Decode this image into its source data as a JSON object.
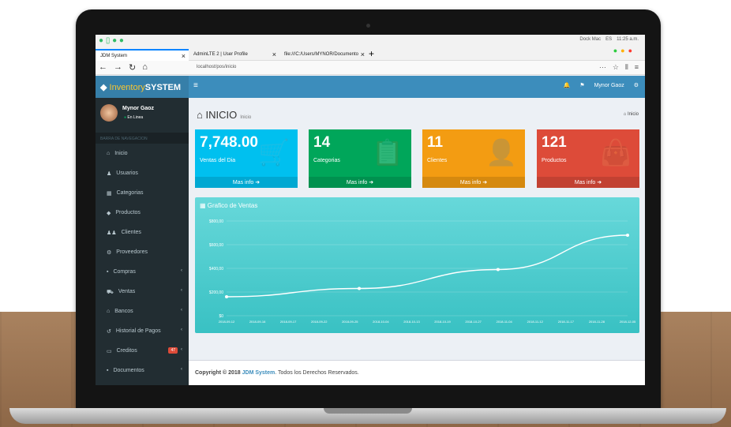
{
  "os": {
    "right_items": [
      "Dock Mac",
      "ES",
      "11:25 a.m."
    ]
  },
  "browser": {
    "tabs": [
      {
        "label": "JDM System",
        "active": true
      },
      {
        "label": "AdminLTE 2 | User Profile",
        "active": false
      },
      {
        "label": "file:///C:/Users/MYNOR/Documento",
        "active": false
      }
    ],
    "url": "localhost/pos/inicio"
  },
  "app": {
    "logo_light": "Inventory",
    "logo_bold": "SYSTEM",
    "menu_icon": "bars-icon",
    "header_user": "Mynor Gaoz"
  },
  "sidebar": {
    "user_name": "Mynor Gaoz",
    "user_status": "En Linea",
    "nav_header": "BARRA DE NAVEGACION",
    "items": [
      {
        "icon": "home-icon",
        "label": "Inicio"
      },
      {
        "icon": "user-icon",
        "label": "Usuarios"
      },
      {
        "icon": "table-icon",
        "label": "Categorias"
      },
      {
        "icon": "tag-icon",
        "label": "Productos"
      },
      {
        "icon": "users-icon",
        "label": "Clientes"
      },
      {
        "icon": "truck-icon",
        "label": "Proveedores"
      },
      {
        "icon": "briefcase-icon",
        "label": "Compras"
      },
      {
        "icon": "cart-icon",
        "label": "Ventas"
      },
      {
        "icon": "bank-icon",
        "label": "Bancos"
      },
      {
        "icon": "history-icon",
        "label": "Historial de Pagos"
      },
      {
        "icon": "credit-card-icon",
        "label": "Creditos",
        "badge": "47"
      },
      {
        "icon": "folder-icon",
        "label": "Documentos"
      }
    ]
  },
  "page": {
    "title": "INICIO",
    "subtitle": "Inicio",
    "breadcrumb": "Inicio"
  },
  "boxes": [
    {
      "value": "7,748.00",
      "label": "Ventas del Dia",
      "link": "Mas info",
      "color": "#00c0ef",
      "icon": "cart-icon"
    },
    {
      "value": "14",
      "label": "Categorias",
      "link": "Mas info",
      "color": "#00a65a",
      "icon": "clipboard-icon"
    },
    {
      "value": "11",
      "label": "Clientes",
      "link": "Mas info",
      "color": "#f39c12",
      "icon": "user-plus-icon"
    },
    {
      "value": "121",
      "label": "Productos",
      "link": "Mas info",
      "color": "#dd4b39",
      "icon": "bag-icon"
    }
  ],
  "chart_title": "Grafico de Ventas",
  "chart_data": {
    "type": "line",
    "title": "Grafico de Ventas",
    "y_ticks": [
      "$0",
      "$200,00",
      "$400,00",
      "$600,00",
      "$800,00"
    ],
    "ylim": [
      0,
      800
    ],
    "x_ticks": [
      "2018-09-12",
      "2018-09-16",
      "2018-09-17",
      "2018-09-22",
      "2018-09-25",
      "2018-10-04",
      "2018-10-13",
      "2018-10-19",
      "2018-10-27",
      "2018-11-04",
      "2018-11-12",
      "2018-11-17",
      "2018-11-28",
      "2018-12-05"
    ],
    "points": [
      {
        "x_index": 0,
        "y": 160
      },
      {
        "x_index": 4.3,
        "y": 230
      },
      {
        "x_index": 8.8,
        "y": 390
      },
      {
        "x_index": 13,
        "y": 680
      }
    ],
    "grid": true
  },
  "footer": {
    "prefix": "Copyright © 2018 ",
    "link": "JDM System",
    "suffix": ". Todos los Derechos Reservados."
  }
}
